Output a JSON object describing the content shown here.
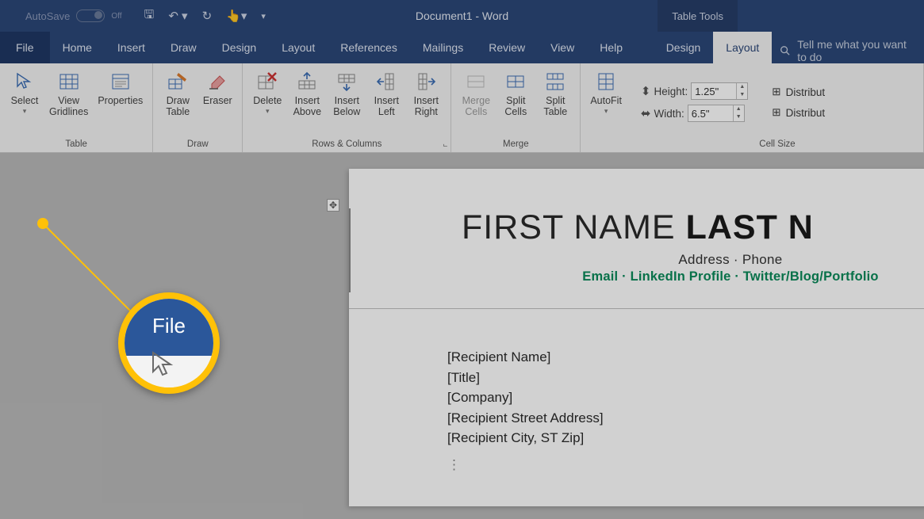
{
  "title": {
    "autosave_label": "AutoSave",
    "autosave_state": "Off",
    "doc_name": "Document1  -  Word",
    "table_tools": "Table Tools"
  },
  "tabs": {
    "file": "File",
    "home": "Home",
    "insert": "Insert",
    "draw": "Draw",
    "design": "Design",
    "layout": "Layout",
    "references": "References",
    "mailings": "Mailings",
    "review": "Review",
    "view": "View",
    "help": "Help",
    "t_design": "Design",
    "t_layout": "Layout",
    "tell_me": "Tell me what you want to do"
  },
  "ribbon": {
    "table_group": {
      "label": "Table",
      "select": "Select",
      "view_gridlines_1": "View",
      "view_gridlines_2": "Gridlines",
      "properties": "Properties"
    },
    "draw_group": {
      "label": "Draw",
      "draw_table_1": "Draw",
      "draw_table_2": "Table",
      "eraser": "Eraser"
    },
    "rows_cols_group": {
      "label": "Rows & Columns",
      "delete": "Delete",
      "insert_above_1": "Insert",
      "insert_above_2": "Above",
      "insert_below_1": "Insert",
      "insert_below_2": "Below",
      "insert_left_1": "Insert",
      "insert_left_2": "Left",
      "insert_right_1": "Insert",
      "insert_right_2": "Right"
    },
    "merge_group": {
      "label": "Merge",
      "merge_cells_1": "Merge",
      "merge_cells_2": "Cells",
      "split_cells_1": "Split",
      "split_cells_2": "Cells",
      "split_table_1": "Split",
      "split_table_2": "Table"
    },
    "autofit": {
      "label": "AutoFit",
      "caret": "▾"
    },
    "cell_size": {
      "label": "Cell Size",
      "height_label": "Height:",
      "height_value": "1.25\"",
      "width_label": "Width:",
      "width_value": "6.5\"",
      "distribute_rows": "Distribut",
      "distribute_cols": "Distribut"
    }
  },
  "callout": {
    "file_label": "File"
  },
  "doc": {
    "first_name": "FIRST NAME ",
    "last_name": "LAST N",
    "addr": "Address · Phone",
    "links": "Email · LinkedIn Profile · Twitter/Blog/Portfolio",
    "l1": "[Recipient Name]",
    "l2": "[Title]",
    "l3": "[Company]",
    "l4": "[Recipient Street Address]",
    "l5": "[Recipient City, ST Zip]",
    "dots": "⋮"
  }
}
